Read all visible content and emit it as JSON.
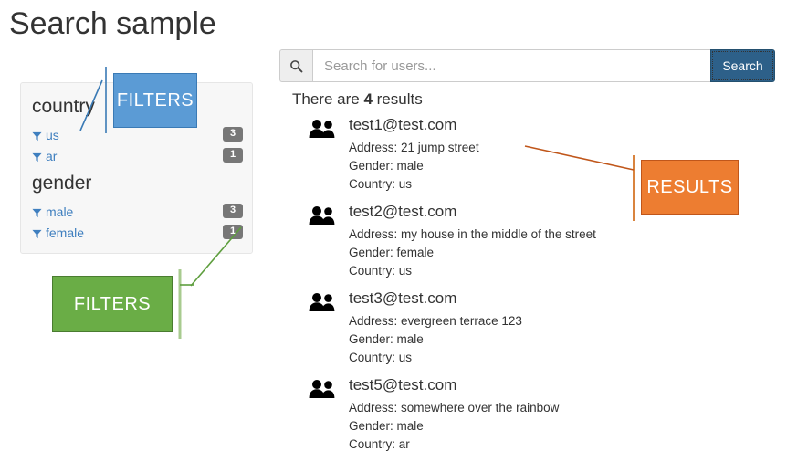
{
  "page": {
    "title": "Search sample"
  },
  "search": {
    "icon": "search-icon",
    "placeholder": "Search for users...",
    "value": "",
    "button_label": "Search"
  },
  "filters": {
    "panel_label": "filters-panel",
    "facets": [
      {
        "name": "country",
        "title": "country",
        "options": [
          {
            "label": "us",
            "count": "3",
            "icon": "filter-funnel-icon"
          },
          {
            "label": "ar",
            "count": "1",
            "icon": "filter-funnel-icon"
          }
        ]
      },
      {
        "name": "gender",
        "title": "gender",
        "options": [
          {
            "label": "male",
            "count": "3",
            "icon": "filter-funnel-icon"
          },
          {
            "label": "female",
            "count": "1",
            "icon": "filter-funnel-icon"
          }
        ]
      }
    ]
  },
  "results": {
    "count_prefix": "There are ",
    "count": "4",
    "count_suffix": " results",
    "items": [
      {
        "icon": "users-icon",
        "email": "test1@test.com",
        "address": "Address: 21 jump street",
        "gender": "Gender: male",
        "country": "Country: us"
      },
      {
        "icon": "users-icon",
        "email": "test2@test.com",
        "address": "Address: my house in the middle of the street",
        "gender": "Gender: female",
        "country": "Country: us"
      },
      {
        "icon": "users-icon",
        "email": "test3@test.com",
        "address": "Address: evergreen terrace 123",
        "gender": "Gender: male",
        "country": "Country: us"
      },
      {
        "icon": "users-icon",
        "email": "test5@test.com",
        "address": "Address: somewhere over the rainbow",
        "gender": "Gender: male",
        "country": "Country: ar"
      }
    ]
  },
  "annotations": {
    "filters_blue": {
      "label": "FILTERS",
      "color": "#5b9bd5"
    },
    "filters_green": {
      "label": "FILTERS",
      "color": "#6aad46"
    },
    "results_orange": {
      "label": "RESULTS",
      "color": "#ed7d31"
    }
  },
  "colors": {
    "link": "#3f7fbf",
    "badge": "#777777",
    "panel_bg": "#f7f7f7",
    "search_button": "#2d6089",
    "annotation_blue": "#5b9bd5",
    "annotation_green": "#6aad46",
    "annotation_orange": "#ed7d31"
  }
}
